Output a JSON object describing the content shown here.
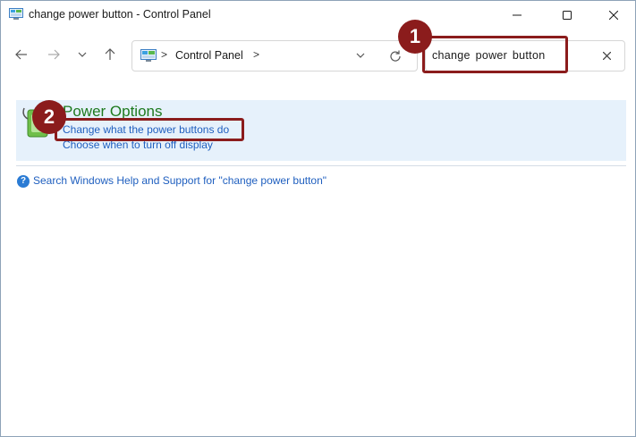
{
  "window": {
    "title": "change power button - Control Panel",
    "icon": "control-panel-icon",
    "caption_buttons": [
      "minimize-icon",
      "maximize-icon",
      "close-icon"
    ]
  },
  "navigation": {
    "buttons": [
      "back-arrow-icon",
      "forward-arrow-icon",
      "recent-chevron-icon",
      "up-arrow-icon"
    ]
  },
  "address_bar": {
    "crumb": "Control Panel",
    "separator": ">",
    "icons": [
      "control-panel-icon",
      "chevron-down-icon",
      "refresh-icon"
    ]
  },
  "search": {
    "value": "change power button",
    "clear_icon": "close-icon"
  },
  "result": {
    "title": "Power Options",
    "icon": "power-options-icon",
    "links": [
      "Change what the power buttons do",
      "Choose when to turn off display"
    ]
  },
  "help": {
    "icon": "help-icon",
    "glyph": "?",
    "link": "Search Windows Help and Support for \"change power button\""
  },
  "annotations": {
    "badge1": "1",
    "badge2": "2",
    "color": "#8b1c1c"
  },
  "colors": {
    "link": "#1f5fbf",
    "result_title": "#1e7a1e",
    "result_bg": "#e6f1fb"
  }
}
